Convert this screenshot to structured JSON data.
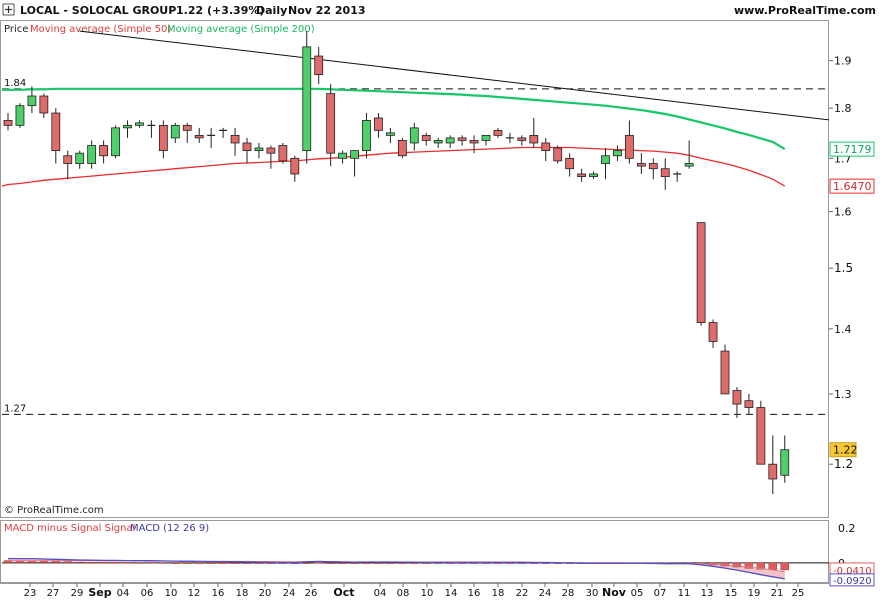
{
  "header": {
    "symbol": "LOCAL - SOLOCAL GROUP",
    "quote": "1.22 (+3.39%)",
    "period": "Daily",
    "date": "Nov 22 2013",
    "site": "www.ProRealTime.com",
    "watermark": "© ProRealTime.com"
  },
  "legend": {
    "price": "Price",
    "ma50": "Moving average (Simple 50)",
    "ma200": "Moving average (Simple 200)"
  },
  "macd_legend": {
    "hist": "MACD minus Signal Signal",
    "macd": "MACD (12 26 9)"
  },
  "colors": {
    "up": "#4ecf6a",
    "down": "#e06b6b",
    "ma50": "#ee2b2b",
    "ma200": "#16c765",
    "trend": "#111111",
    "macd_line": "#5050c8",
    "signal_fill": "#f3b7bd",
    "hist": "#e05c5c",
    "last_price_bg": "#f6c834"
  },
  "chart_data": [
    {
      "type": "candlestick",
      "title": "LOCAL - SOLOCAL GROUP",
      "yaxis": {
        "ticks": [
          1.9,
          1.8,
          1.7,
          1.6,
          1.5,
          1.4,
          1.3,
          1.2
        ],
        "labels": [
          "1.9",
          "1.8",
          "1.7",
          "1.6",
          "1.5",
          "1.4",
          "1.3",
          "1.2"
        ],
        "ylim": [
          1.13,
          1.99
        ],
        "scale": "log"
      },
      "xaxis": {
        "labels": [
          "23",
          "27",
          "29",
          "Sep",
          "04",
          "06",
          "10",
          "12",
          "16",
          "18",
          "20",
          "24",
          "26",
          "Oct",
          "04",
          "08",
          "10",
          "14",
          "16",
          "18",
          "22",
          "24",
          "28",
          "30",
          "Nov",
          "05",
          "07",
          "11",
          "13",
          "15",
          "19",
          "21",
          "25"
        ],
        "bold": [
          "Sep",
          "Oct",
          "Nov"
        ]
      },
      "hlines": [
        {
          "value": 1.84,
          "label": "1.84"
        },
        {
          "value": 1.27,
          "label": "1.27"
        }
      ],
      "trendline": {
        "from": {
          "index": 6,
          "value": 1.965
        },
        "to_axis": {
          "value": 1.776
        }
      },
      "badges": [
        {
          "value": 1.7179,
          "label": "1.7179",
          "series": "ma200"
        },
        {
          "value": 1.647,
          "label": "1.6470",
          "series": "ma50"
        },
        {
          "value": 1.22,
          "label": "1.22",
          "series": "price"
        }
      ],
      "ohlc": [
        [
          1.775,
          1.79,
          1.755,
          1.765
        ],
        [
          1.765,
          1.81,
          1.76,
          1.805
        ],
        [
          1.805,
          1.845,
          1.79,
          1.825
        ],
        [
          1.825,
          1.83,
          1.78,
          1.79
        ],
        [
          1.79,
          1.8,
          1.69,
          1.715
        ],
        [
          1.705,
          1.715,
          1.66,
          1.69
        ],
        [
          1.69,
          1.715,
          1.68,
          1.71
        ],
        [
          1.69,
          1.735,
          1.68,
          1.725
        ],
        [
          1.725,
          1.735,
          1.69,
          1.705
        ],
        [
          1.705,
          1.765,
          1.7,
          1.76
        ],
        [
          1.76,
          1.775,
          1.74,
          1.765
        ],
        [
          1.765,
          1.775,
          1.76,
          1.77
        ],
        [
          1.765,
          1.775,
          1.74,
          1.765
        ],
        [
          1.765,
          1.775,
          1.7,
          1.715
        ],
        [
          1.74,
          1.77,
          1.73,
          1.765
        ],
        [
          1.765,
          1.77,
          1.73,
          1.755
        ],
        [
          1.745,
          1.76,
          1.73,
          1.74
        ],
        [
          1.745,
          1.76,
          1.72,
          1.745
        ],
        [
          1.755,
          1.76,
          1.74,
          1.755
        ],
        [
          1.745,
          1.76,
          1.705,
          1.73
        ],
        [
          1.73,
          1.74,
          1.69,
          1.715
        ],
        [
          1.715,
          1.73,
          1.7,
          1.72
        ],
        [
          1.72,
          1.725,
          1.68,
          1.71
        ],
        [
          1.725,
          1.73,
          1.69,
          1.695
        ],
        [
          1.7,
          1.705,
          1.655,
          1.67
        ],
        [
          1.715,
          1.965,
          1.69,
          1.93
        ],
        [
          1.91,
          1.93,
          1.85,
          1.87
        ],
        [
          1.83,
          1.85,
          1.685,
          1.71
        ],
        [
          1.7,
          1.715,
          1.69,
          1.71
        ],
        [
          1.7,
          1.715,
          1.665,
          1.715
        ],
        [
          1.715,
          1.79,
          1.7,
          1.775
        ],
        [
          1.78,
          1.79,
          1.74,
          1.755
        ],
        [
          1.745,
          1.76,
          1.73,
          1.75
        ],
        [
          1.735,
          1.74,
          1.7,
          1.705
        ],
        [
          1.73,
          1.77,
          1.715,
          1.76
        ],
        [
          1.745,
          1.75,
          1.725,
          1.735
        ],
        [
          1.73,
          1.74,
          1.72,
          1.735
        ],
        [
          1.73,
          1.745,
          1.72,
          1.74
        ],
        [
          1.74,
          1.745,
          1.725,
          1.735
        ],
        [
          1.735,
          1.745,
          1.71,
          1.73
        ],
        [
          1.735,
          1.745,
          1.725,
          1.745
        ],
        [
          1.755,
          1.76,
          1.74,
          1.745
        ],
        [
          1.74,
          1.75,
          1.73,
          1.74
        ],
        [
          1.74,
          1.745,
          1.725,
          1.735
        ],
        [
          1.745,
          1.78,
          1.72,
          1.73
        ],
        [
          1.73,
          1.74,
          1.695,
          1.715
        ],
        [
          1.72,
          1.725,
          1.69,
          1.695
        ],
        [
          1.7,
          1.71,
          1.665,
          1.68
        ],
        [
          1.67,
          1.68,
          1.655,
          1.665
        ],
        [
          1.665,
          1.675,
          1.66,
          1.67
        ],
        [
          1.69,
          1.72,
          1.66,
          1.705
        ],
        [
          1.705,
          1.725,
          1.695,
          1.715
        ],
        [
          1.745,
          1.775,
          1.69,
          1.7
        ],
        [
          1.69,
          1.71,
          1.67,
          1.685
        ],
        [
          1.69,
          1.7,
          1.66,
          1.68
        ],
        [
          1.68,
          1.7,
          1.64,
          1.665
        ],
        [
          1.67,
          1.675,
          1.655,
          1.67
        ],
        [
          1.685,
          1.735,
          1.68,
          1.69
        ],
        [
          1.58,
          1.58,
          1.405,
          1.41
        ],
        [
          1.41,
          1.415,
          1.37,
          1.38
        ],
        [
          1.365,
          1.375,
          1.3,
          1.3
        ],
        [
          1.305,
          1.31,
          1.265,
          1.285
        ],
        [
          1.29,
          1.3,
          1.27,
          1.28
        ],
        [
          1.28,
          1.29,
          1.2,
          1.2
        ],
        [
          1.2,
          1.24,
          1.16,
          1.18
        ],
        [
          1.185,
          1.24,
          1.175,
          1.22
        ]
      ],
      "ma50": [
        1.65,
        1.652,
        1.655,
        1.658,
        1.66,
        1.662,
        1.664,
        1.666,
        1.668,
        1.67,
        1.672,
        1.674,
        1.676,
        1.678,
        1.68,
        1.682,
        1.684,
        1.686,
        1.688,
        1.69,
        1.691,
        1.692,
        1.693,
        1.694,
        1.695,
        1.697,
        1.699,
        1.7,
        1.702,
        1.704,
        1.706,
        1.708,
        1.71,
        1.711,
        1.712,
        1.713,
        1.714,
        1.715,
        1.716,
        1.717,
        1.718,
        1.719,
        1.72,
        1.721,
        1.721,
        1.721,
        1.721,
        1.721,
        1.72,
        1.719,
        1.718,
        1.717,
        1.716,
        1.715,
        1.714,
        1.712,
        1.71,
        1.706,
        1.7,
        1.695,
        1.69,
        1.684,
        1.677,
        1.669,
        1.66,
        1.647
      ],
      "ma200": [
        1.838,
        1.838,
        1.839,
        1.839,
        1.84,
        1.84,
        1.84,
        1.84,
        1.84,
        1.84,
        1.84,
        1.84,
        1.84,
        1.84,
        1.84,
        1.84,
        1.84,
        1.84,
        1.84,
        1.84,
        1.84,
        1.84,
        1.84,
        1.84,
        1.84,
        1.84,
        1.84,
        1.839,
        1.838,
        1.837,
        1.836,
        1.835,
        1.834,
        1.833,
        1.832,
        1.831,
        1.83,
        1.829,
        1.828,
        1.826,
        1.825,
        1.823,
        1.821,
        1.819,
        1.817,
        1.815,
        1.813,
        1.811,
        1.809,
        1.807,
        1.805,
        1.802,
        1.799,
        1.796,
        1.792,
        1.788,
        1.783,
        1.777,
        1.771,
        1.765,
        1.759,
        1.752,
        1.746,
        1.739,
        1.732,
        1.7179
      ]
    },
    {
      "type": "macd",
      "title": "MACD (12 26 9)",
      "yaxis": {
        "ticks": [
          0.2,
          0,
          -0.041,
          -0.092
        ],
        "labels": [
          "0.2",
          "0",
          "-0.0410",
          "-0.0920"
        ],
        "ylim": [
          -0.11,
          0.24
        ]
      },
      "last_values": {
        "hist": -0.041,
        "macd": -0.092
      },
      "macd": [
        0.025,
        0.024,
        0.024,
        0.022,
        0.02,
        0.018,
        0.016,
        0.015,
        0.014,
        0.014,
        0.013,
        0.012,
        0.012,
        0.011,
        0.01,
        0.009,
        0.008,
        0.007,
        0.007,
        0.006,
        0.005,
        0.004,
        0.003,
        0.002,
        0.001,
        0.006,
        0.008,
        0.006,
        0.005,
        0.004,
        0.005,
        0.005,
        0.005,
        0.004,
        0.004,
        0.003,
        0.003,
        0.003,
        0.003,
        0.003,
        0.003,
        0.003,
        0.003,
        0.003,
        0.002,
        0.001,
        0.0,
        -0.001,
        -0.002,
        -0.003,
        -0.003,
        -0.003,
        -0.003,
        -0.003,
        -0.004,
        -0.005,
        -0.005,
        -0.005,
        -0.012,
        -0.02,
        -0.03,
        -0.042,
        -0.055,
        -0.068,
        -0.08,
        -0.092
      ],
      "signal": [
        0.012,
        0.012,
        0.012,
        0.012,
        0.012,
        0.012,
        0.012,
        0.012,
        0.011,
        0.011,
        0.011,
        0.011,
        0.01,
        0.01,
        0.01,
        0.01,
        0.009,
        0.009,
        0.009,
        0.008,
        0.008,
        0.007,
        0.007,
        0.006,
        0.006,
        0.006,
        0.006,
        0.006,
        0.006,
        0.005,
        0.005,
        0.005,
        0.005,
        0.005,
        0.005,
        0.004,
        0.004,
        0.004,
        0.004,
        0.004,
        0.004,
        0.004,
        0.003,
        0.003,
        0.003,
        0.003,
        0.002,
        0.002,
        0.001,
        0.001,
        0.0,
        0.0,
        -0.001,
        -0.001,
        -0.002,
        -0.002,
        -0.003,
        -0.003,
        -0.005,
        -0.008,
        -0.012,
        -0.018,
        -0.024,
        -0.032,
        -0.041,
        -0.051
      ],
      "hist": [
        0.013,
        0.012,
        0.012,
        0.01,
        0.008,
        0.006,
        0.004,
        0.003,
        0.003,
        0.003,
        0.002,
        0.001,
        0.002,
        0.001,
        0.0,
        -0.001,
        -0.001,
        -0.002,
        -0.002,
        -0.002,
        -0.003,
        -0.003,
        -0.004,
        -0.004,
        -0.005,
        0.0,
        0.002,
        0.0,
        -0.001,
        -0.001,
        0.0,
        0.0,
        0.0,
        -0.001,
        -0.001,
        -0.001,
        -0.001,
        -0.001,
        -0.001,
        -0.001,
        -0.001,
        -0.001,
        0.0,
        0.0,
        -0.001,
        -0.002,
        -0.002,
        -0.003,
        -0.003,
        -0.004,
        -0.003,
        -0.003,
        -0.002,
        -0.002,
        -0.002,
        -0.003,
        -0.002,
        -0.002,
        -0.007,
        -0.012,
        -0.018,
        -0.024,
        -0.031,
        -0.036,
        -0.039,
        -0.041
      ]
    }
  ]
}
